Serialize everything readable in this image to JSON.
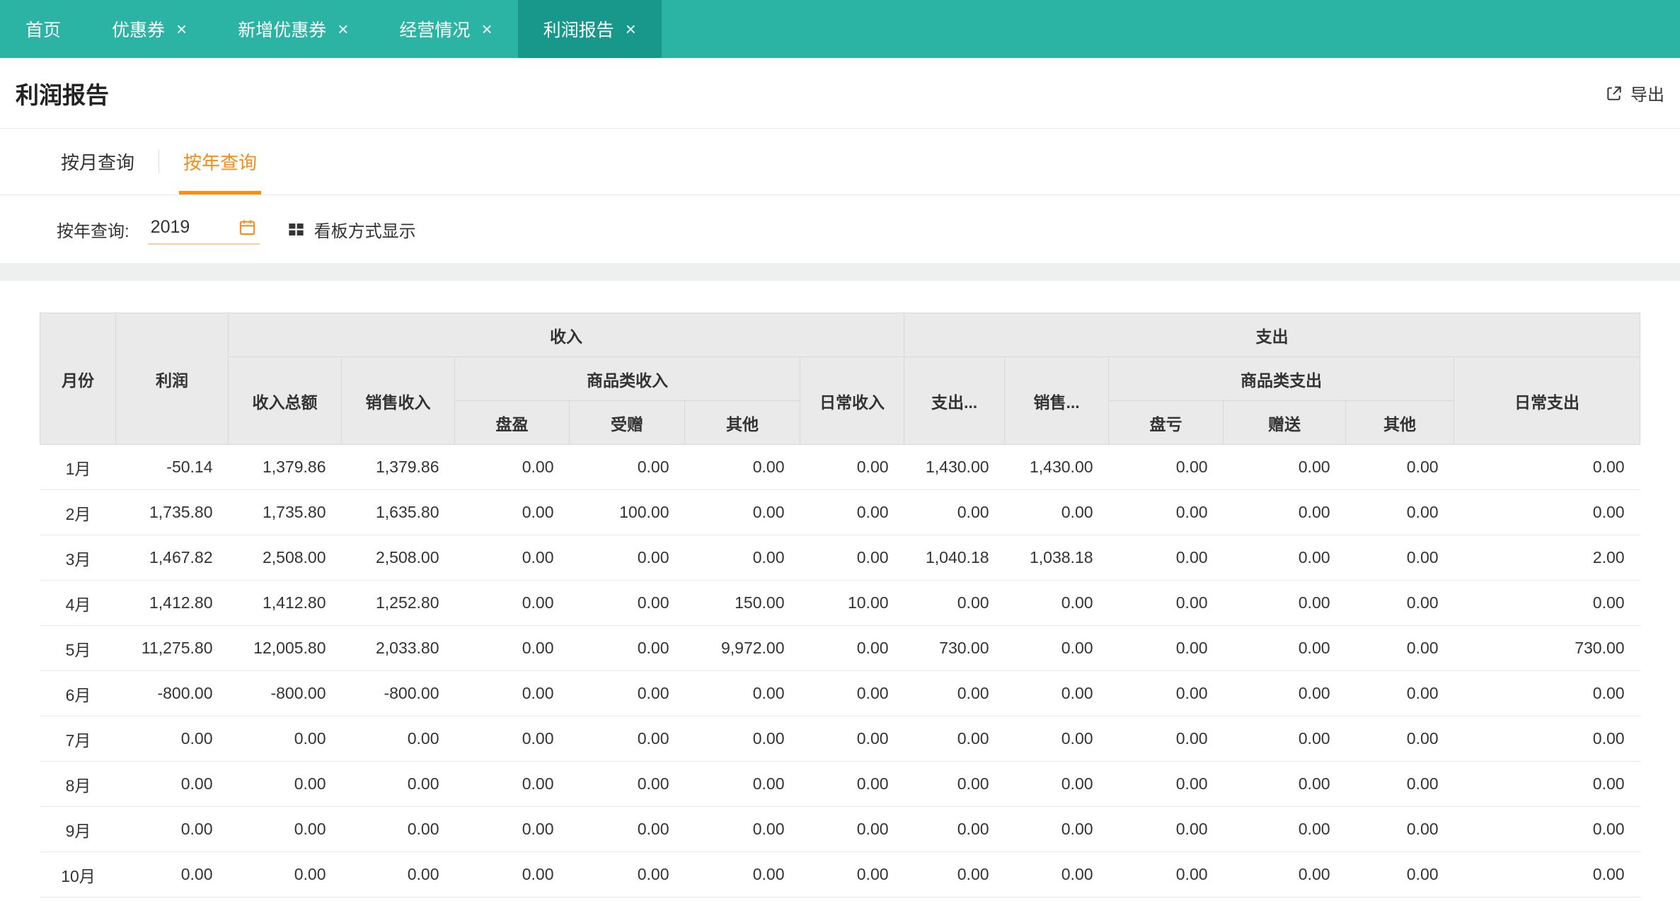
{
  "colors": {
    "nav_teal": "#2bb3a3",
    "nav_teal_active": "#17988b",
    "accent_orange": "#fa8c16"
  },
  "nav": {
    "tabs": [
      {
        "label": "首页",
        "closable": false,
        "active": false
      },
      {
        "label": "优惠券",
        "closable": true,
        "active": false
      },
      {
        "label": "新增优惠券",
        "closable": true,
        "active": false
      },
      {
        "label": "经营情况",
        "closable": true,
        "active": false
      },
      {
        "label": "利润报告",
        "closable": true,
        "active": true
      }
    ]
  },
  "header": {
    "title": "利润报告",
    "export_label": "导出"
  },
  "query_tabs": [
    {
      "label": "按月查询",
      "active": false
    },
    {
      "label": "按年查询",
      "active": true
    }
  ],
  "filter": {
    "label": "按年查询:",
    "year_value": "2019",
    "board_view_label": "看板方式显示"
  },
  "table": {
    "header": {
      "month": "月份",
      "profit": "利润",
      "income_group": "收入",
      "expense_group": "支出",
      "income_total": "收入总额",
      "sales_income": "销售收入",
      "goods_income_group": "商品类收入",
      "daily_income": "日常收入",
      "expense_total": "支出...",
      "sales_expense": "销售...",
      "goods_expense_group": "商品类支出",
      "daily_expense": "日常支出",
      "surplus_in": "盘盈",
      "donated_in": "受赠",
      "other_in": "其他",
      "deficit_out": "盘亏",
      "gift_out": "赠送",
      "other_out": "其他"
    },
    "rows": [
      {
        "month": "1月",
        "values": [
          "-50.14",
          "1,379.86",
          "1,379.86",
          "0.00",
          "0.00",
          "0.00",
          "0.00",
          "1,430.00",
          "1,430.00",
          "0.00",
          "0.00",
          "0.00",
          "0.00"
        ]
      },
      {
        "month": "2月",
        "values": [
          "1,735.80",
          "1,735.80",
          "1,635.80",
          "0.00",
          "100.00",
          "0.00",
          "0.00",
          "0.00",
          "0.00",
          "0.00",
          "0.00",
          "0.00",
          "0.00"
        ]
      },
      {
        "month": "3月",
        "values": [
          "1,467.82",
          "2,508.00",
          "2,508.00",
          "0.00",
          "0.00",
          "0.00",
          "0.00",
          "1,040.18",
          "1,038.18",
          "0.00",
          "0.00",
          "0.00",
          "2.00"
        ]
      },
      {
        "month": "4月",
        "values": [
          "1,412.80",
          "1,412.80",
          "1,252.80",
          "0.00",
          "0.00",
          "150.00",
          "10.00",
          "0.00",
          "0.00",
          "0.00",
          "0.00",
          "0.00",
          "0.00"
        ]
      },
      {
        "month": "5月",
        "values": [
          "11,275.80",
          "12,005.80",
          "2,033.80",
          "0.00",
          "0.00",
          "9,972.00",
          "0.00",
          "730.00",
          "0.00",
          "0.00",
          "0.00",
          "0.00",
          "730.00"
        ]
      },
      {
        "month": "6月",
        "values": [
          "-800.00",
          "-800.00",
          "-800.00",
          "0.00",
          "0.00",
          "0.00",
          "0.00",
          "0.00",
          "0.00",
          "0.00",
          "0.00",
          "0.00",
          "0.00"
        ]
      },
      {
        "month": "7月",
        "values": [
          "0.00",
          "0.00",
          "0.00",
          "0.00",
          "0.00",
          "0.00",
          "0.00",
          "0.00",
          "0.00",
          "0.00",
          "0.00",
          "0.00",
          "0.00"
        ]
      },
      {
        "month": "8月",
        "values": [
          "0.00",
          "0.00",
          "0.00",
          "0.00",
          "0.00",
          "0.00",
          "0.00",
          "0.00",
          "0.00",
          "0.00",
          "0.00",
          "0.00",
          "0.00"
        ]
      },
      {
        "month": "9月",
        "values": [
          "0.00",
          "0.00",
          "0.00",
          "0.00",
          "0.00",
          "0.00",
          "0.00",
          "0.00",
          "0.00",
          "0.00",
          "0.00",
          "0.00",
          "0.00"
        ]
      },
      {
        "month": "10月",
        "values": [
          "0.00",
          "0.00",
          "0.00",
          "0.00",
          "0.00",
          "0.00",
          "0.00",
          "0.00",
          "0.00",
          "0.00",
          "0.00",
          "0.00",
          "0.00"
        ]
      }
    ]
  }
}
